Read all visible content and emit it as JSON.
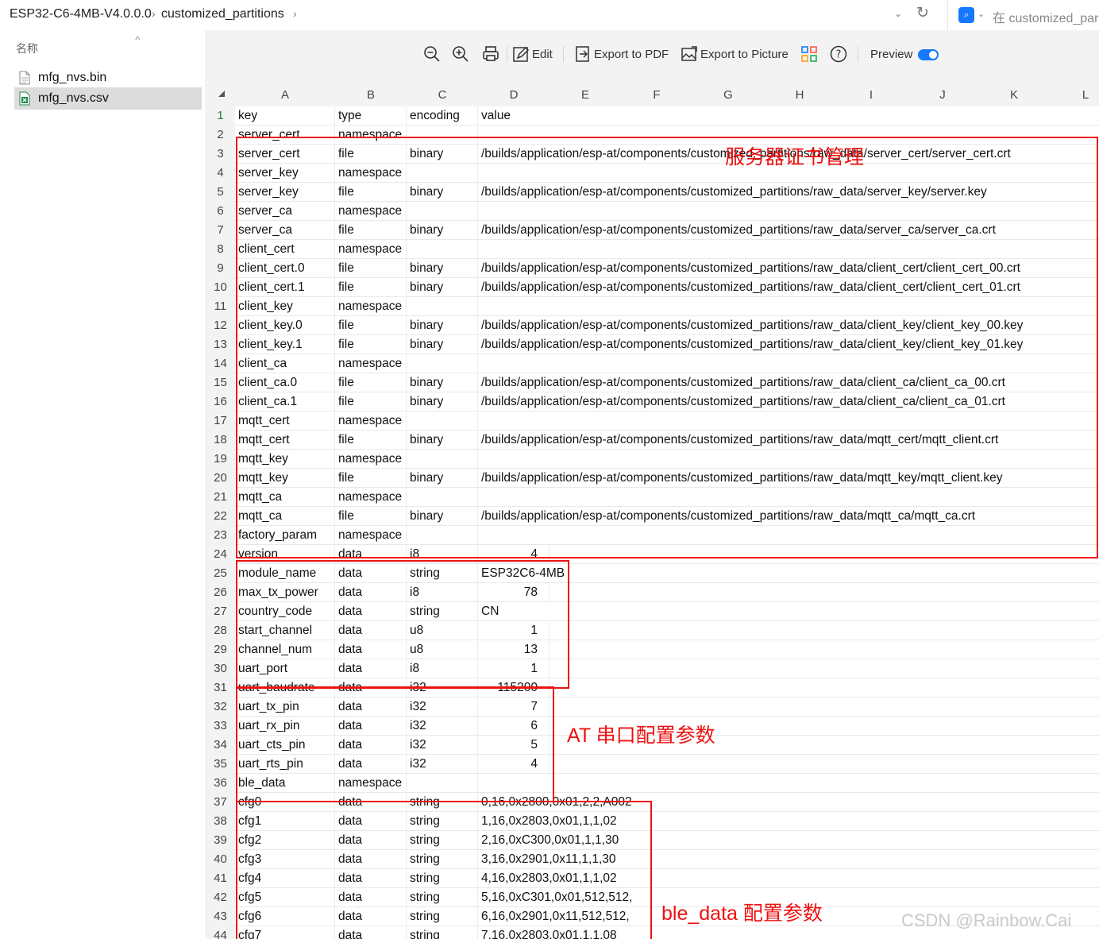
{
  "address_bar": {
    "crumbs": [
      "ESP32-C6-4MB-V4.0.0.0",
      "customized_partitions"
    ],
    "search_placeholder": "在 customized_par"
  },
  "sidebar": {
    "header": "名称",
    "files": [
      {
        "name": "mfg_nvs.bin",
        "icon": "document-icon",
        "selected": false
      },
      {
        "name": "mfg_nvs.csv",
        "icon": "spreadsheet-icon",
        "selected": true
      }
    ]
  },
  "toolbar": {
    "edit": "Edit",
    "export_pdf": "Export to PDF",
    "export_picture": "Export to Picture",
    "preview": "Preview",
    "preview_on": true
  },
  "sheet": {
    "columns": [
      "A",
      "B",
      "C",
      "D",
      "E",
      "F",
      "G",
      "H",
      "I",
      "J",
      "K",
      "L"
    ],
    "rows": [
      [
        "1",
        "key",
        "type",
        "encoding",
        "value"
      ],
      [
        "2",
        "server_cert",
        "namespace",
        "",
        ""
      ],
      [
        "3",
        "server_cert",
        "file",
        "binary",
        "/builds/application/esp-at/components/customized_partitions/raw_data/server_cert/server_cert.crt"
      ],
      [
        "4",
        "server_key",
        "namespace",
        "",
        ""
      ],
      [
        "5",
        "server_key",
        "file",
        "binary",
        "/builds/application/esp-at/components/customized_partitions/raw_data/server_key/server.key"
      ],
      [
        "6",
        "server_ca",
        "namespace",
        "",
        ""
      ],
      [
        "7",
        "server_ca",
        "file",
        "binary",
        "/builds/application/esp-at/components/customized_partitions/raw_data/server_ca/server_ca.crt"
      ],
      [
        "8",
        "client_cert",
        "namespace",
        "",
        ""
      ],
      [
        "9",
        "client_cert.0",
        "file",
        "binary",
        "/builds/application/esp-at/components/customized_partitions/raw_data/client_cert/client_cert_00.crt"
      ],
      [
        "10",
        "client_cert.1",
        "file",
        "binary",
        "/builds/application/esp-at/components/customized_partitions/raw_data/client_cert/client_cert_01.crt"
      ],
      [
        "11",
        "client_key",
        "namespace",
        "",
        ""
      ],
      [
        "12",
        "client_key.0",
        "file",
        "binary",
        "/builds/application/esp-at/components/customized_partitions/raw_data/client_key/client_key_00.key"
      ],
      [
        "13",
        "client_key.1",
        "file",
        "binary",
        "/builds/application/esp-at/components/customized_partitions/raw_data/client_key/client_key_01.key"
      ],
      [
        "14",
        "client_ca",
        "namespace",
        "",
        ""
      ],
      [
        "15",
        "client_ca.0",
        "file",
        "binary",
        "/builds/application/esp-at/components/customized_partitions/raw_data/client_ca/client_ca_00.crt"
      ],
      [
        "16",
        "client_ca.1",
        "file",
        "binary",
        "/builds/application/esp-at/components/customized_partitions/raw_data/client_ca/client_ca_01.crt"
      ],
      [
        "17",
        "mqtt_cert",
        "namespace",
        "",
        ""
      ],
      [
        "18",
        "mqtt_cert",
        "file",
        "binary",
        "/builds/application/esp-at/components/customized_partitions/raw_data/mqtt_cert/mqtt_client.crt"
      ],
      [
        "19",
        "mqtt_key",
        "namespace",
        "",
        ""
      ],
      [
        "20",
        "mqtt_key",
        "file",
        "binary",
        "/builds/application/esp-at/components/customized_partitions/raw_data/mqtt_key/mqtt_client.key"
      ],
      [
        "21",
        "mqtt_ca",
        "namespace",
        "",
        ""
      ],
      [
        "22",
        "mqtt_ca",
        "file",
        "binary",
        "/builds/application/esp-at/components/customized_partitions/raw_data/mqtt_ca/mqtt_ca.crt"
      ],
      [
        "23",
        "factory_param",
        "namespace",
        "",
        ""
      ],
      [
        "24",
        "version",
        "data",
        "i8",
        "4"
      ],
      [
        "25",
        "module_name",
        "data",
        "string",
        "ESP32C6-4MB"
      ],
      [
        "26",
        "max_tx_power",
        "data",
        "i8",
        "78"
      ],
      [
        "27",
        "country_code",
        "data",
        "string",
        "CN"
      ],
      [
        "28",
        "start_channel",
        "data",
        "u8",
        "1"
      ],
      [
        "29",
        "channel_num",
        "data",
        "u8",
        "13"
      ],
      [
        "30",
        "uart_port",
        "data",
        "i8",
        "1"
      ],
      [
        "31",
        "uart_baudrate",
        "data",
        "i32",
        "115200"
      ],
      [
        "32",
        "uart_tx_pin",
        "data",
        "i32",
        "7"
      ],
      [
        "33",
        "uart_rx_pin",
        "data",
        "i32",
        "6"
      ],
      [
        "34",
        "uart_cts_pin",
        "data",
        "i32",
        "5"
      ],
      [
        "35",
        "uart_rts_pin",
        "data",
        "i32",
        "4"
      ],
      [
        "36",
        "ble_data",
        "namespace",
        "",
        ""
      ],
      [
        "37",
        "cfg0",
        "data",
        "string",
        "0,16,0x2800,0x01,2,2,A002"
      ],
      [
        "38",
        "cfg1",
        "data",
        "string",
        "1,16,0x2803,0x01,1,1,02"
      ],
      [
        "39",
        "cfg2",
        "data",
        "string",
        "2,16,0xC300,0x01,1,1,30"
      ],
      [
        "40",
        "cfg3",
        "data",
        "string",
        "3,16,0x2901,0x11,1,1,30"
      ],
      [
        "41",
        "cfg4",
        "data",
        "string",
        "4,16,0x2803,0x01,1,1,02"
      ],
      [
        "42",
        "cfg5",
        "data",
        "string",
        "5,16,0xC301,0x01,512,512,"
      ],
      [
        "43",
        "cfg6",
        "data",
        "string",
        "6,16,0x2901,0x11,512,512,"
      ],
      [
        "44",
        "cfg7",
        "data",
        "string",
        "7,16,0x2803,0x01,1,1,08"
      ]
    ]
  },
  "annotations": {
    "server_cert_mgmt": "服务器证书管理",
    "at_uart": "AT 串口配置参数",
    "ble_data": "ble_data 配置参数"
  },
  "watermark": "CSDN @Rainbow.Cai",
  "colors": {
    "annotation_red": "#ee1111",
    "accent_blue": "#1677ff"
  }
}
